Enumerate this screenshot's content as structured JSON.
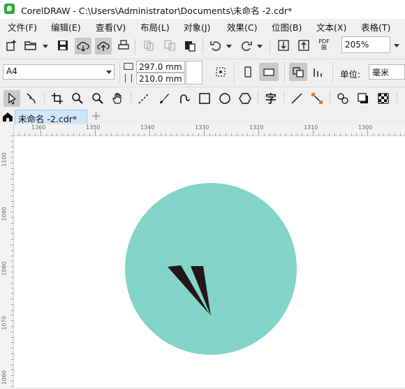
{
  "window": {
    "title": "CorelDRAW - C:\\Users\\Administrator\\Documents\\未命名 -2.cdr*"
  },
  "menu": [
    {
      "label": "文件(F)"
    },
    {
      "label": "编辑(E)"
    },
    {
      "label": "查看(V)"
    },
    {
      "label": "布局(L)"
    },
    {
      "label": "对象(J)"
    },
    {
      "label": "效果(C)"
    },
    {
      "label": "位图(B)"
    },
    {
      "label": "文本(X)"
    },
    {
      "label": "表格(T)"
    }
  ],
  "standard_toolbar": {
    "zoom_value": "205%",
    "icons": [
      "new-document-icon",
      "open-icon",
      "save-icon",
      "cloud-download-icon",
      "cloud-upload-icon",
      "print-icon",
      "copy-disabled-icon",
      "paste-disabled-icon",
      "clipboard-icon",
      "undo-icon",
      "redo-icon",
      "import-icon",
      "export-icon",
      "pdf-icon"
    ],
    "pdf_label": "PDF"
  },
  "property_bar": {
    "page_size": "A4",
    "width": "297.0 mm",
    "height": "210.0 mm",
    "units_label": "单位:",
    "units_value": "毫米"
  },
  "toolbox": {
    "icons": [
      "pick-tool-icon",
      "shape-tool-icon",
      "crop-tool-icon",
      "zoom-tool-icon",
      "zoom-out-tool-icon",
      "pan-tool-icon",
      "freehand-tool-icon",
      "artistic-media-tool-icon",
      "spiral-tool-icon",
      "rectangle-tool-icon",
      "ellipse-tool-icon",
      "polygon-tool-icon",
      "text-tool-icon",
      "dimension-tool-icon",
      "connector-tool-icon",
      "blend-tool-icon",
      "drop-shadow-tool-icon",
      "transparency-tool-icon"
    ],
    "text_tool_glyph": "字"
  },
  "tabs": {
    "document": "未命名 -2.cdr*"
  },
  "rulers": {
    "horizontal": [
      "1360",
      "1350",
      "1340",
      "1330",
      "1320",
      "1310",
      "1300"
    ],
    "vertical": [
      "1100",
      "1090",
      "1080",
      "1070",
      "1060"
    ]
  },
  "artwork": {
    "circle_color": "#82d5c8",
    "mark_color": "#231815"
  }
}
